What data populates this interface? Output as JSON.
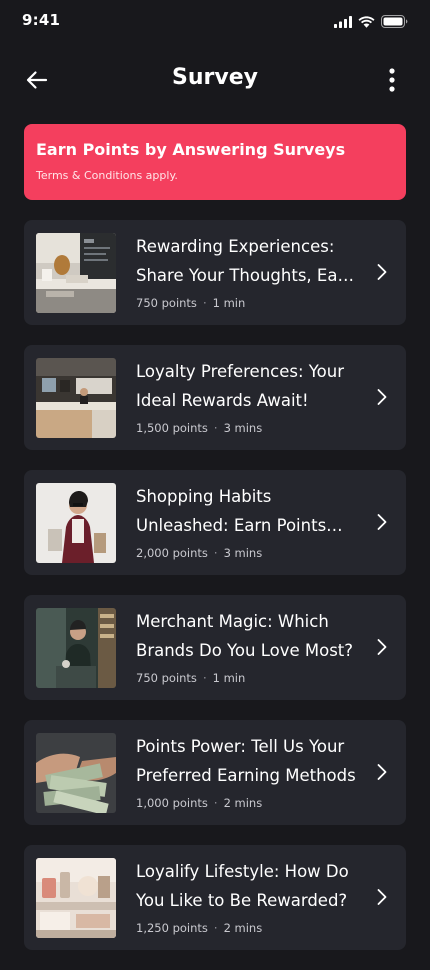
{
  "status_bar": {
    "time": "9:41"
  },
  "header": {
    "title": "Survey"
  },
  "banner": {
    "title": "Earn Points by Answering Surveys",
    "subtitle": "Terms & Conditions apply."
  },
  "surveys": [
    {
      "title": "Rewarding Experiences: Share Your Thoughts, Earn Rewards",
      "points": "750 points",
      "duration": "1 min",
      "thumbnail": "cafe-photo"
    },
    {
      "title": "Loyalty Preferences: Your Ideal Rewards Await!",
      "points": "1,500 points",
      "duration": "3 mins",
      "thumbnail": "store-counter-photo"
    },
    {
      "title": "Shopping Habits Unleashed: Earn Points With Us",
      "points": "2,000 points",
      "duration": "3 mins",
      "thumbnail": "shopper-with-bags-photo"
    },
    {
      "title": "Merchant Magic: Which Brands Do You Love Most?",
      "points": "750 points",
      "duration": "1 min",
      "thumbnail": "barista-photo"
    },
    {
      "title": "Points Power: Tell Us Your Preferred Earning Methods",
      "points": "1,000 points",
      "duration": "2 mins",
      "thumbnail": "cash-in-hands-photo"
    },
    {
      "title": "Loyalify Lifestyle: How Do You Like to Be Rewarded?",
      "points": "1,250 points",
      "duration": "2 mins",
      "thumbnail": "lifestyle-products-photo"
    }
  ],
  "colors": {
    "background": "#18181c",
    "card": "#25262d",
    "accent": "#f43f5e"
  }
}
